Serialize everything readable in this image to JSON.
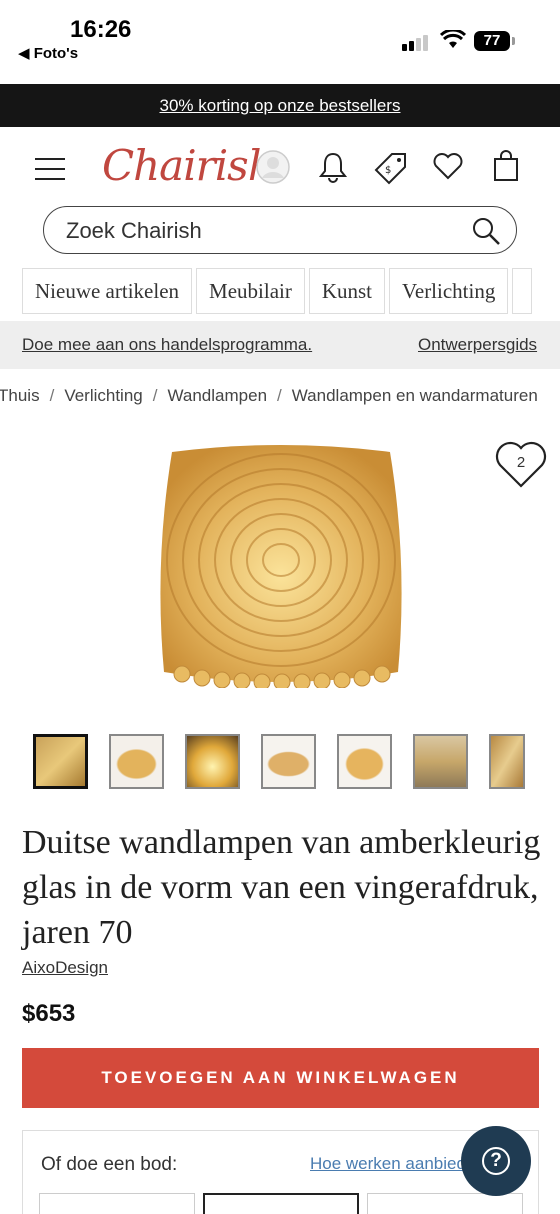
{
  "status_bar": {
    "time": "16:26",
    "back_label": "◀ Foto's",
    "battery": "77"
  },
  "promo": {
    "text": "30% korting op onze bestsellers"
  },
  "header": {
    "logo": "Chairish",
    "icons": [
      "menu-icon",
      "user-icon",
      "bell-icon",
      "price-tag-icon",
      "heart-icon",
      "shopping-bag-icon"
    ]
  },
  "search": {
    "placeholder": "Zoek Chairish"
  },
  "categories": [
    "Nieuwe artikelen",
    "Meubilair",
    "Kunst",
    "Verlichting"
  ],
  "trade_bar": {
    "left_link": "Doe mee aan ons handelsprogramma.",
    "right_link": "Ontwerpersgids"
  },
  "breadcrumb": [
    "Thuis",
    "Verlichting",
    "Wandlampen",
    "Wandlampen en wandarmaturen"
  ],
  "product": {
    "favorite_count": "2",
    "title": "Duitse wandlampen van amberkleurig glas in de vorm van een vingerafdruk, jaren 70",
    "maker": "AixoDesign",
    "price": "$653",
    "add_to_cart": "TOEVOEGEN AAN WINKELWAGEN",
    "thumbnail_count": 7
  },
  "offer": {
    "label": "Of doe een bod:",
    "link": "Hoe werken aanbiedingen?"
  },
  "help": {
    "label": "?"
  },
  "colors": {
    "brand": "#c0473f",
    "cta": "#d44a3b",
    "help_button": "#1f3b52",
    "amber": "#e0b35a"
  }
}
